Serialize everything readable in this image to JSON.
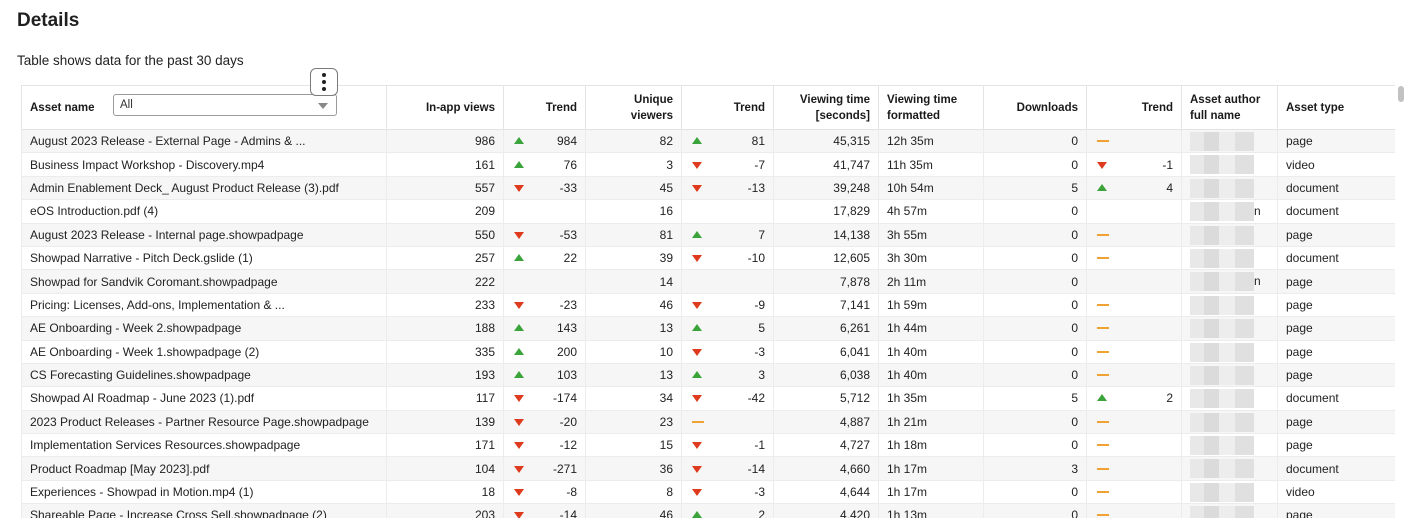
{
  "section_title": "Details",
  "subtitle": "Table shows data for the past 30 days",
  "filter": {
    "value": "All"
  },
  "columns": {
    "asset_name": "Asset name",
    "in_app_views": "In-app views",
    "trend": "Trend",
    "unique_viewers": "Unique viewers",
    "viewing_time_seconds": "Viewing time [seconds]",
    "viewing_time_formatted": "Viewing time formatted",
    "downloads": "Downloads",
    "asset_author": "Asset author full name",
    "asset_type": "Asset type"
  },
  "colors": {
    "up": "#3aa33a",
    "down": "#de3a1d",
    "flat": "#f0a233"
  },
  "rows": [
    {
      "name": "August 2023 Release - External Page - Admins & ...",
      "views": "986",
      "vt_dir": "up",
      "vt_val": "984",
      "uniq": "82",
      "ut_dir": "up",
      "ut_val": "81",
      "secs": "45,315",
      "fmt": "12h 35m",
      "dl": "0",
      "dt_dir": "flat",
      "dt_val": "",
      "author": "",
      "type": "page"
    },
    {
      "name": "Business Impact Workshop - Discovery.mp4",
      "views": "161",
      "vt_dir": "up",
      "vt_val": "76",
      "uniq": "3",
      "ut_dir": "down",
      "ut_val": "-7",
      "secs": "41,747",
      "fmt": "11h 35m",
      "dl": "0",
      "dt_dir": "down",
      "dt_val": "-1",
      "author": "",
      "type": "video"
    },
    {
      "name": "Admin Enablement Deck_ August Product Release (3).pdf",
      "views": "557",
      "vt_dir": "down",
      "vt_val": "-33",
      "uniq": "45",
      "ut_dir": "down",
      "ut_val": "-13",
      "secs": "39,248",
      "fmt": "10h 54m",
      "dl": "5",
      "dt_dir": "up",
      "dt_val": "4",
      "author": "",
      "type": "document"
    },
    {
      "name": "eOS Introduction.pdf (4)",
      "views": "209",
      "vt_dir": "",
      "vt_val": "",
      "uniq": "16",
      "ut_dir": "",
      "ut_val": "",
      "secs": "17,829",
      "fmt": "4h 57m",
      "dl": "0",
      "dt_dir": "",
      "dt_val": "",
      "author": "n",
      "type": "document"
    },
    {
      "name": "August 2023 Release - Internal page.showpadpage",
      "views": "550",
      "vt_dir": "down",
      "vt_val": "-53",
      "uniq": "81",
      "ut_dir": "up",
      "ut_val": "7",
      "secs": "14,138",
      "fmt": "3h 55m",
      "dl": "0",
      "dt_dir": "flat",
      "dt_val": "",
      "author": "",
      "type": "page"
    },
    {
      "name": "Showpad Narrative - Pitch Deck.gslide (1)",
      "views": "257",
      "vt_dir": "up",
      "vt_val": "22",
      "uniq": "39",
      "ut_dir": "down",
      "ut_val": "-10",
      "secs": "12,605",
      "fmt": "3h 30m",
      "dl": "0",
      "dt_dir": "flat",
      "dt_val": "",
      "author": "",
      "type": "document"
    },
    {
      "name": "Showpad for Sandvik Coromant.showpadpage",
      "views": "222",
      "vt_dir": "",
      "vt_val": "",
      "uniq": "14",
      "ut_dir": "",
      "ut_val": "",
      "secs": "7,878",
      "fmt": "2h 11m",
      "dl": "0",
      "dt_dir": "",
      "dt_val": "",
      "author": "n",
      "type": "page"
    },
    {
      "name": "Pricing: Licenses, Add-ons, Implementation & ...",
      "views": "233",
      "vt_dir": "down",
      "vt_val": "-23",
      "uniq": "46",
      "ut_dir": "down",
      "ut_val": "-9",
      "secs": "7,141",
      "fmt": "1h 59m",
      "dl": "0",
      "dt_dir": "flat",
      "dt_val": "",
      "author": "",
      "type": "page"
    },
    {
      "name": "AE Onboarding - Week 2.showpadpage",
      "views": "188",
      "vt_dir": "up",
      "vt_val": "143",
      "uniq": "13",
      "ut_dir": "up",
      "ut_val": "5",
      "secs": "6,261",
      "fmt": "1h 44m",
      "dl": "0",
      "dt_dir": "flat",
      "dt_val": "",
      "author": "",
      "type": "page"
    },
    {
      "name": "AE Onboarding - Week 1.showpadpage (2)",
      "views": "335",
      "vt_dir": "up",
      "vt_val": "200",
      "uniq": "10",
      "ut_dir": "down",
      "ut_val": "-3",
      "secs": "6,041",
      "fmt": "1h 40m",
      "dl": "0",
      "dt_dir": "flat",
      "dt_val": "",
      "author": "",
      "type": "page"
    },
    {
      "name": "CS Forecasting Guidelines.showpadpage",
      "views": "193",
      "vt_dir": "up",
      "vt_val": "103",
      "uniq": "13",
      "ut_dir": "up",
      "ut_val": "3",
      "secs": "6,038",
      "fmt": "1h 40m",
      "dl": "0",
      "dt_dir": "flat",
      "dt_val": "",
      "author": "",
      "type": "page"
    },
    {
      "name": "Showpad AI Roadmap - June 2023 (1).pdf",
      "views": "117",
      "vt_dir": "down",
      "vt_val": "-174",
      "uniq": "34",
      "ut_dir": "down",
      "ut_val": "-42",
      "secs": "5,712",
      "fmt": "1h 35m",
      "dl": "5",
      "dt_dir": "up",
      "dt_val": "2",
      "author": "",
      "type": "document"
    },
    {
      "name": "2023 Product Releases - Partner Resource Page.showpadpage",
      "views": "139",
      "vt_dir": "down",
      "vt_val": "-20",
      "uniq": "23",
      "ut_dir": "flat",
      "ut_val": "",
      "secs": "4,887",
      "fmt": "1h 21m",
      "dl": "0",
      "dt_dir": "flat",
      "dt_val": "",
      "author": "",
      "type": "page"
    },
    {
      "name": "Implementation Services Resources.showpadpage",
      "views": "171",
      "vt_dir": "down",
      "vt_val": "-12",
      "uniq": "15",
      "ut_dir": "down",
      "ut_val": "-1",
      "secs": "4,727",
      "fmt": "1h 18m",
      "dl": "0",
      "dt_dir": "flat",
      "dt_val": "",
      "author": "",
      "type": "page"
    },
    {
      "name": "Product Roadmap [May 2023].pdf",
      "views": "104",
      "vt_dir": "down",
      "vt_val": "-271",
      "uniq": "36",
      "ut_dir": "down",
      "ut_val": "-14",
      "secs": "4,660",
      "fmt": "1h 17m",
      "dl": "3",
      "dt_dir": "flat",
      "dt_val": "",
      "author": "",
      "type": "document"
    },
    {
      "name": "Experiences - Showpad in Motion.mp4 (1)",
      "views": "18",
      "vt_dir": "down",
      "vt_val": "-8",
      "uniq": "8",
      "ut_dir": "down",
      "ut_val": "-3",
      "secs": "4,644",
      "fmt": "1h 17m",
      "dl": "0",
      "dt_dir": "flat",
      "dt_val": "",
      "author": "",
      "type": "video"
    },
    {
      "name": "Shareable Page - Increase Cross Sell.showpadpage (2)",
      "views": "203",
      "vt_dir": "down",
      "vt_val": "-14",
      "uniq": "46",
      "ut_dir": "up",
      "ut_val": "2",
      "secs": "4,420",
      "fmt": "1h 13m",
      "dl": "0",
      "dt_dir": "flat",
      "dt_val": "",
      "author": "",
      "type": "page"
    }
  ]
}
